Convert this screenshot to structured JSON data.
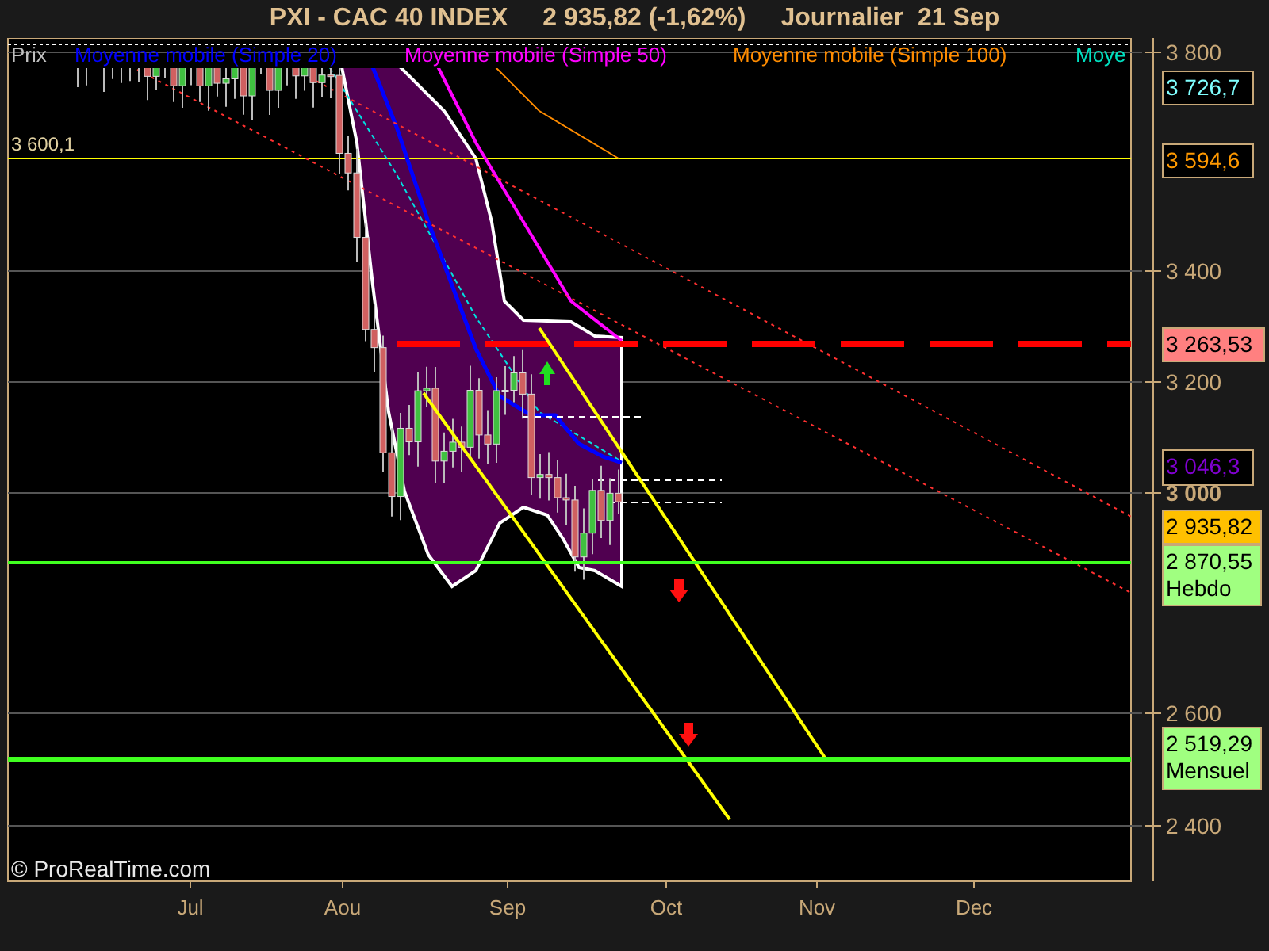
{
  "header": {
    "title": "PXI - CAC 40 INDEX",
    "quote": "2 935,82 (-1,62%)",
    "period": "Journalier  21 Sep"
  },
  "legend": [
    {
      "label": "Prix",
      "color": "#c0c0c0"
    },
    {
      "label": "Moyenne mobile (Simple 20)",
      "color": "#0000ff"
    },
    {
      "label": "Moyenne mobile (Simple 50)",
      "color": "#ff00ff"
    },
    {
      "label": "Moyenne mobile (Simple 100)",
      "color": "#ff8c00"
    },
    {
      "label": "Moye",
      "color": "#00e0c0"
    }
  ],
  "level_label": "3 600,1",
  "y_axis": [
    "3 800",
    "3 400",
    "3 200",
    "3 000",
    "2 600",
    "2 400"
  ],
  "x_axis": [
    "Jul",
    "Aou",
    "Sep",
    "Oct",
    "Nov",
    "Dec"
  ],
  "price_tags": [
    {
      "lines": [
        "3 726,7"
      ],
      "kind": "outline",
      "color": "#80ffff"
    },
    {
      "lines": [
        "3 594,6"
      ],
      "kind": "outline",
      "color": "#ff9900"
    },
    {
      "lines": [
        "3 263,53"
      ],
      "kind": "filled",
      "color": "#ff8080"
    },
    {
      "lines": [
        "3 046,3"
      ],
      "kind": "outline",
      "color": "#8000d0"
    },
    {
      "lines": [
        "2 935,82"
      ],
      "kind": "filled",
      "color": "#ffc000"
    },
    {
      "lines": [
        "2 870,55",
        "Hebdo"
      ],
      "kind": "filled",
      "color": "#a0ff80"
    },
    {
      "lines": [
        "2 519,29",
        "Mensuel"
      ],
      "kind": "filled",
      "color": "#a0ff80"
    }
  ],
  "copyright": "© ProRealTime.com"
}
